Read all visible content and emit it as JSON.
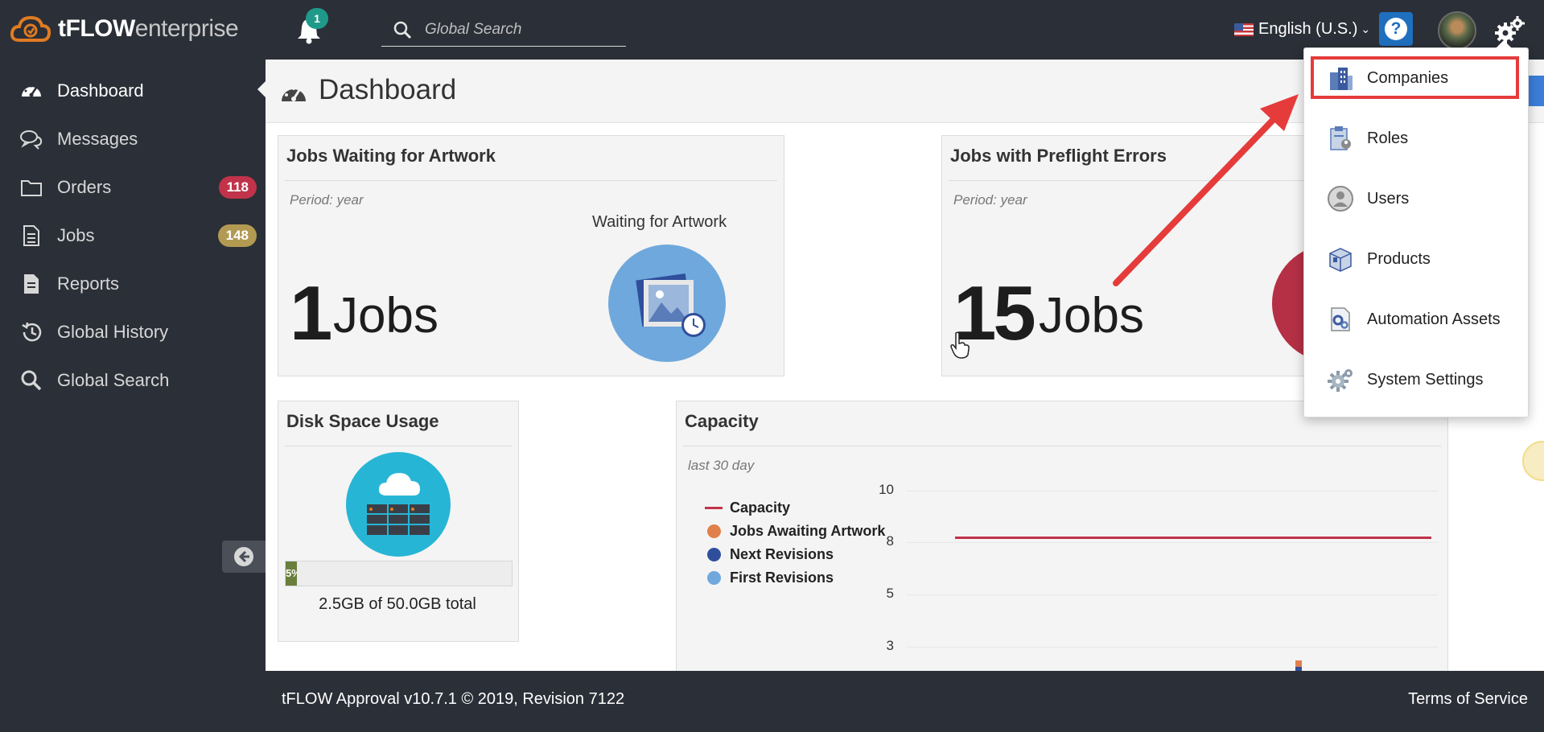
{
  "app": {
    "logo_brand": "tFLOW",
    "logo_suffix": "enterprise",
    "notification_count": "1",
    "search_placeholder": "Global Search",
    "language": "English (U.S.)",
    "help_label": "?"
  },
  "sidebar": {
    "items": [
      {
        "label": "Dashboard",
        "icon": "dashboard-icon",
        "active": true
      },
      {
        "label": "Messages",
        "icon": "messages-icon"
      },
      {
        "label": "Orders",
        "icon": "folder-icon",
        "badge": "118",
        "badge_color": "#c0334a"
      },
      {
        "label": "Jobs",
        "icon": "document-icon",
        "badge": "148",
        "badge_color": "#b39a52"
      },
      {
        "label": "Reports",
        "icon": "report-icon"
      },
      {
        "label": "Global History",
        "icon": "history-icon"
      },
      {
        "label": "Global Search",
        "icon": "search-icon"
      }
    ]
  },
  "page": {
    "title": "Dashboard"
  },
  "cards": {
    "waiting": {
      "title": "Jobs Waiting for Artwork",
      "period": "Period: year",
      "count": "1",
      "unit": "Jobs",
      "chart_label": "Waiting for Artwork"
    },
    "preflight": {
      "title": "Jobs with Preflight Errors",
      "period": "Period: year",
      "count": "15",
      "unit": "Jobs"
    },
    "disk": {
      "title": "Disk Space Usage",
      "percent_label": "5%",
      "used_fraction": 0.05,
      "total_text": "2.5GB of 50.0GB total"
    },
    "capacity": {
      "title": "Capacity",
      "period": "last 30 day"
    }
  },
  "chart_data": {
    "type": "line",
    "title": "Capacity",
    "subtitle": "last 30 day",
    "y_ticks": [
      "10",
      "8",
      "5",
      "3"
    ],
    "series": [
      {
        "name": "Capacity",
        "color": "#c0334a",
        "value": 8.5
      },
      {
        "name": "Jobs Awaiting Artwork",
        "color": "#e0804a"
      },
      {
        "name": "Next Revisions",
        "color": "#2f4f9c"
      },
      {
        "name": "First Revisions",
        "color": "#6fa8dc"
      }
    ],
    "legend_position": "top-left"
  },
  "menu": {
    "items": [
      {
        "label": "Companies",
        "icon": "companies-icon",
        "highlighted": true
      },
      {
        "label": "Roles",
        "icon": "roles-icon"
      },
      {
        "label": "Users",
        "icon": "users-icon"
      },
      {
        "label": "Products",
        "icon": "products-icon"
      },
      {
        "label": "Automation Assets",
        "icon": "automation-assets-icon"
      },
      {
        "label": "System Settings",
        "icon": "system-settings-icon"
      }
    ]
  },
  "footer": {
    "version": "tFLOW Approval v10.7.1 © 2019, Revision 7122",
    "terms": "Terms of Service"
  },
  "colors": {
    "sidebar_bg": "#2b2f37",
    "accent_blue": "#1f6fbf",
    "highlight_red": "#e53b3b",
    "bell_badge": "#1f9a8a"
  }
}
